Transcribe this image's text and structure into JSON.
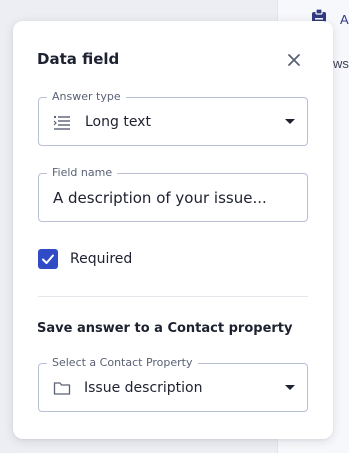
{
  "background": {
    "header_text_fragment": "A",
    "row_text_fragment": "ws"
  },
  "dialog": {
    "title": "Data field",
    "close_icon": "close-icon",
    "answer_type": {
      "legend": "Answer type",
      "value": "Long text",
      "icon": "long-text-icon"
    },
    "field_name": {
      "legend": "Field name",
      "value": "A description of your issue..."
    },
    "required": {
      "label": "Required",
      "checked": true
    },
    "contact_section": {
      "heading": "Save answer to a Contact property",
      "property_select": {
        "legend": "Select a Contact Property",
        "value": "Issue description",
        "icon": "folder-icon"
      }
    }
  },
  "colors": {
    "accent": "#2f4bc6",
    "text": "#1d2130",
    "border": "#b9c0d6"
  }
}
